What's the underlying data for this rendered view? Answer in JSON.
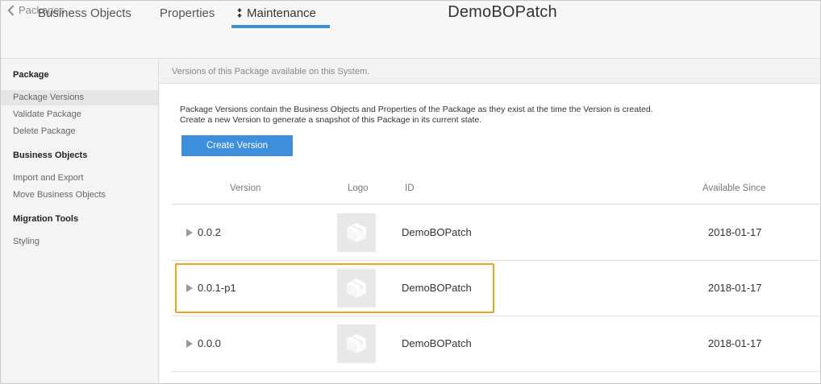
{
  "header": {
    "back_label": "Packages",
    "title": "DemoBOPatch"
  },
  "tabs": [
    {
      "label": "Business Objects"
    },
    {
      "label": "Properties"
    },
    {
      "label": "Maintenance",
      "active": true
    }
  ],
  "sidebar": {
    "sections": [
      {
        "heading": "Package",
        "items": [
          "Package Versions",
          "Validate Package",
          "Delete Package"
        ]
      },
      {
        "heading": "Business Objects",
        "items": [
          "Import and Export",
          "Move Business Objects"
        ]
      },
      {
        "heading": "Migration Tools",
        "items": [
          "Styling"
        ]
      }
    ],
    "selected": "Package Versions"
  },
  "main": {
    "info": "Versions of this Package available on this System.",
    "description_line1": "Package Versions contain the Business Objects and Properties of the Package as they exist at the time the Version is created.",
    "description_line2": "Create a new Version to generate a snapshot of this Package in its current state.",
    "create_button": "Create Version",
    "table": {
      "columns": {
        "version": "Version",
        "logo": "Logo",
        "id": "ID",
        "available_since": "Available Since"
      },
      "rows": [
        {
          "version": "0.0.2",
          "id": "DemoBOPatch",
          "available_since": "2018-01-17"
        },
        {
          "version": "0.0.1-p1",
          "id": "DemoBOPatch",
          "available_since": "2018-01-17"
        },
        {
          "version": "0.0.0",
          "id": "DemoBOPatch",
          "available_since": "2018-01-17"
        }
      ]
    }
  },
  "colors": {
    "accent": "#3d8fdb",
    "highlight": "#f0a31a",
    "logo_bg": "#e8e8e8"
  }
}
